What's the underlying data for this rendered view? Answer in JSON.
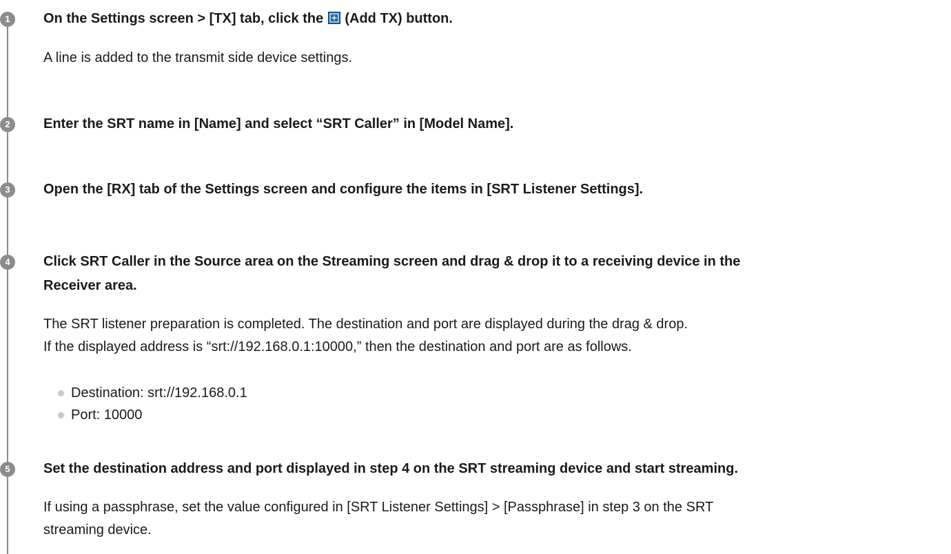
{
  "steps": [
    {
      "number": "1",
      "heading_before": "On the Settings screen > [TX] tab, click the",
      "heading_icon": "add-tx-icon",
      "heading_after": "(Add TX) button.",
      "body": "A line is added to the transmit side device settings."
    },
    {
      "number": "2",
      "heading": "Enter the SRT name in [Name] and select “SRT Caller” in [Model Name]."
    },
    {
      "number": "3",
      "heading": "Open the [RX] tab of the Settings screen and configure the items in [SRT Listener Settings]."
    },
    {
      "number": "4",
      "heading_line1": "Click SRT Caller in the Source area on the Streaming screen and drag & drop it to a receiving device in the",
      "heading_line2": "Receiver area.",
      "body_line1": "The SRT listener preparation is completed. The destination and port are displayed during the drag & drop.",
      "body_line2": "If the displayed address is “srt://192.168.0.1:10000,” then the destination and port are as follows.",
      "bullets": [
        "Destination: srt://192.168.0.1",
        "Port: 10000"
      ]
    },
    {
      "number": "5",
      "heading": "Set the destination address and port displayed in step 4 on the SRT streaming device and start streaming.",
      "body_line1": "If using a passphrase, set the value configured in [SRT Listener Settings] > [Passphrase] in step 3 on the SRT",
      "body_line2": "streaming device."
    }
  ],
  "colors": {
    "badge": "#8c8c8c",
    "timeline": "#8a8a8a",
    "icon_fill": "#1e6aa6",
    "text": "#1a1a1a",
    "bullet": "#c8c8c8"
  }
}
